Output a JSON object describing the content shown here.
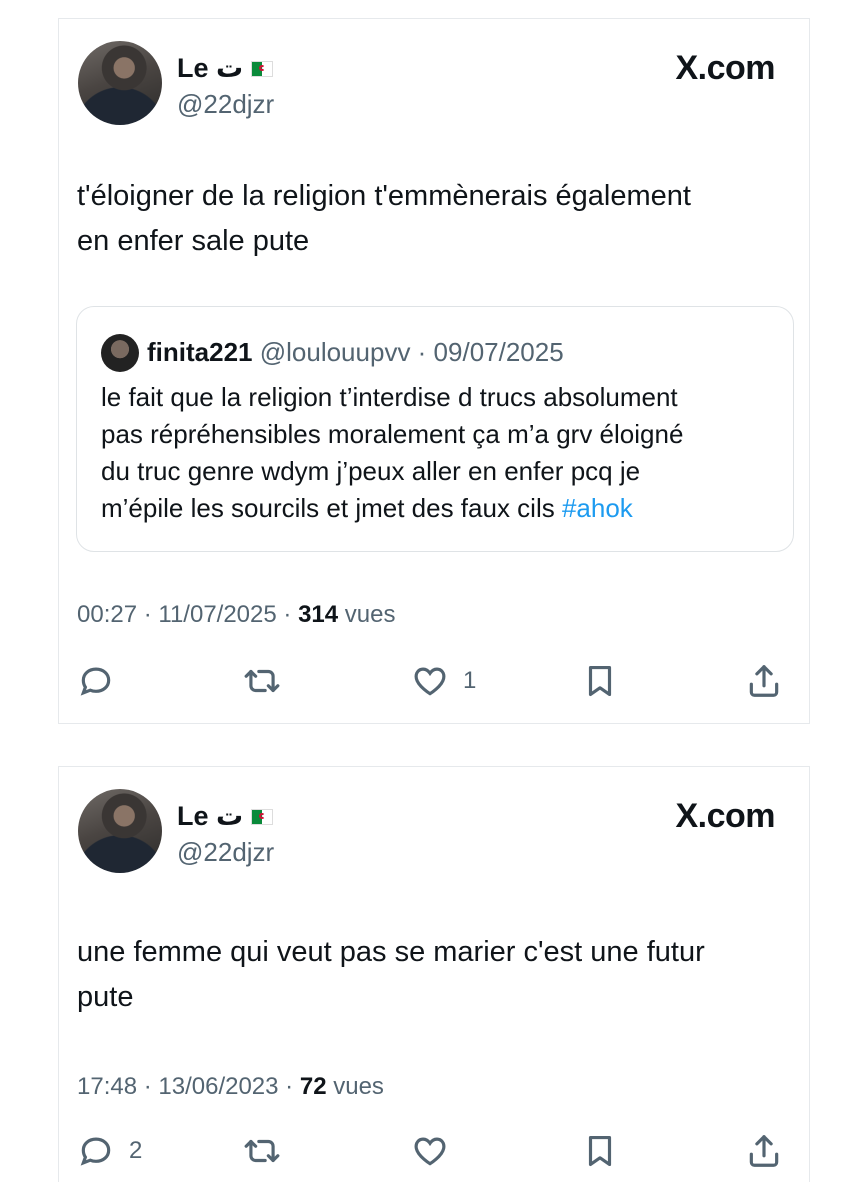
{
  "tweets": [
    {
      "name": "Le ت",
      "handle": "@22djzr",
      "source_logo": "X.com",
      "text_line1": "t'éloigner de la religion t'emmènerais également",
      "text_line2": "en enfer sale pute",
      "quote": {
        "name": "finita221",
        "handle_date": "@loulouupvv · 09/07/2025",
        "line1": "le fait que la religion t’interdise d trucs absolument",
        "line2": "pas répréhensibles moralement ça m’a grv éloigné",
        "line3": "du truc genre wdym j’peux aller en enfer pcq je",
        "line4_text": "m’épile les sourcils et jmet des faux cils ",
        "hashtag": "#ahok"
      },
      "time_date": "00:27 · 11/07/2025 · ",
      "views_count": "314",
      "views_label": " vues",
      "reply_count": "",
      "retweet_count": "",
      "like_count": "1"
    },
    {
      "name": "Le ت",
      "handle": "@22djzr",
      "source_logo": "X.com",
      "text_line1": "une femme qui veut pas se marier c'est une futur",
      "text_line2": "pute",
      "time_date": "17:48 · 13/06/2023 · ",
      "views_count": "72",
      "views_label": " vues",
      "reply_count": "2",
      "retweet_count": "",
      "like_count": ""
    }
  ],
  "colors": {
    "text": "#0f1419",
    "secondary": "#536471",
    "link": "#1d9bf0",
    "border": "#e6e9ec"
  },
  "icons": [
    "reply-icon",
    "retweet-icon",
    "like-icon",
    "bookmark-icon",
    "share-icon",
    "algeria-flag-icon"
  ]
}
